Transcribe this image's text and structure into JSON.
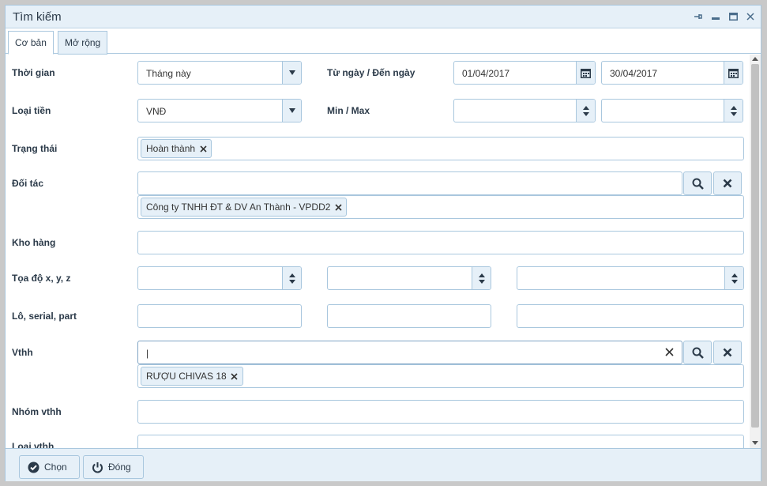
{
  "window": {
    "title": "Tìm kiếm"
  },
  "tabs": [
    {
      "label": "Cơ bản"
    },
    {
      "label": "Mở rộng"
    }
  ],
  "labels": {
    "thoigian": "Thời gian",
    "tungay_denngay": "Từ ngày / Đến ngày",
    "loaitien": "Loại tiền",
    "minmax": "Min / Max",
    "trangthai": "Trạng thái",
    "doitac": "Đối tác",
    "khohang": "Kho hàng",
    "toado": "Tọa độ x, y, z",
    "lo_serial_part": "Lô, serial, part",
    "vthh": "Vthh",
    "nhomvthh": "Nhóm vthh",
    "loaivthh": "Loại vthh"
  },
  "fields": {
    "thoigian_value": "Tháng này",
    "tungay": "01/04/2017",
    "denngay": "30/04/2017",
    "loaitien_value": "VNĐ",
    "vthh_input": "|"
  },
  "tags": {
    "trangthai": "Hoàn thành",
    "doitac": "Công ty TNHH ĐT & DV An Thành - VPDD2",
    "vthh": "RƯỢU CHIVAS 18"
  },
  "footer": {
    "chon": "Chọn",
    "dong": "Đóng"
  },
  "colors": {
    "accent": "#2b3a49",
    "border": "#a9c7de",
    "panel": "#e6f0f8"
  }
}
